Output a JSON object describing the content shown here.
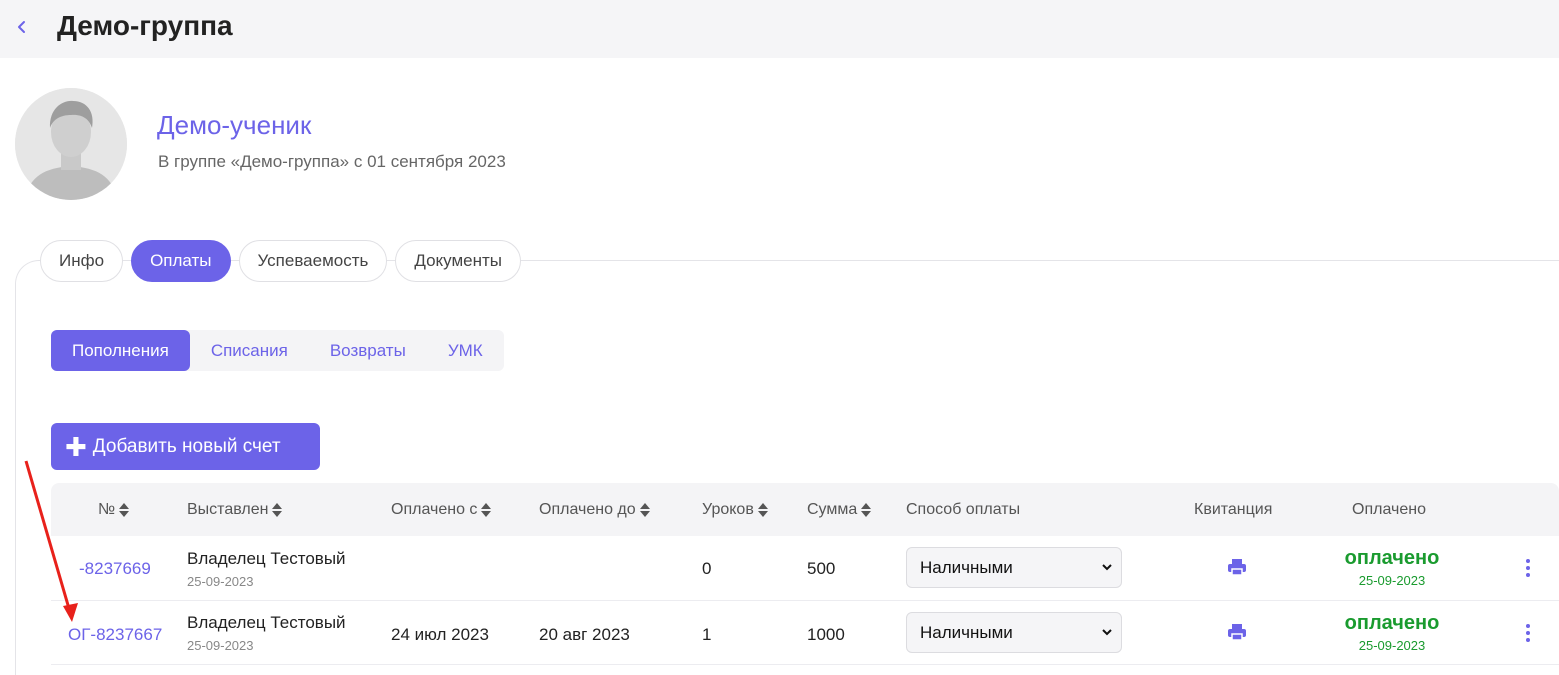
{
  "header": {
    "title": "Демо-группа"
  },
  "student": {
    "name": "Демо-ученик",
    "subtitle": "В группе «Демо-группа» с 01 сентября 2023"
  },
  "tabs": [
    {
      "label": "Инфо",
      "active": false
    },
    {
      "label": "Оплаты",
      "active": true
    },
    {
      "label": "Успеваемость",
      "active": false
    },
    {
      "label": "Документы",
      "active": false
    }
  ],
  "subtabs": [
    {
      "label": "Пополнения",
      "active": true
    },
    {
      "label": "Списания",
      "active": false
    },
    {
      "label": "Возвраты",
      "active": false
    },
    {
      "label": "УМК",
      "active": false
    }
  ],
  "add_button": {
    "label": "Добавить новый счет"
  },
  "table": {
    "columns": {
      "number": "№",
      "issued": "Выставлен",
      "paid_from": "Оплачено с",
      "paid_to": "Оплачено до",
      "lessons": "Уроков",
      "amount": "Сумма",
      "method": "Способ оплаты",
      "receipt": "Квитанция",
      "paid": "Оплачено"
    },
    "rows": [
      {
        "number": "-8237669",
        "payer": "Владелец Тестовый",
        "issued_date": "25-09-2023",
        "paid_from": "",
        "paid_to": "",
        "lessons": "0",
        "amount": "500",
        "method": "Наличными",
        "status": "оплачено",
        "status_date": "25-09-2023"
      },
      {
        "number": "ОГ-8237667",
        "payer": "Владелец Тестовый",
        "issued_date": "25-09-2023",
        "paid_from": "24 июл 2023",
        "paid_to": "20 авг 2023",
        "lessons": "1",
        "amount": "1000",
        "method": "Наличными",
        "status": "оплачено",
        "status_date": "25-09-2023"
      }
    ]
  },
  "colors": {
    "accent": "#6c63e8",
    "paid": "#1a9b2f",
    "annotation": "#e8211b"
  }
}
